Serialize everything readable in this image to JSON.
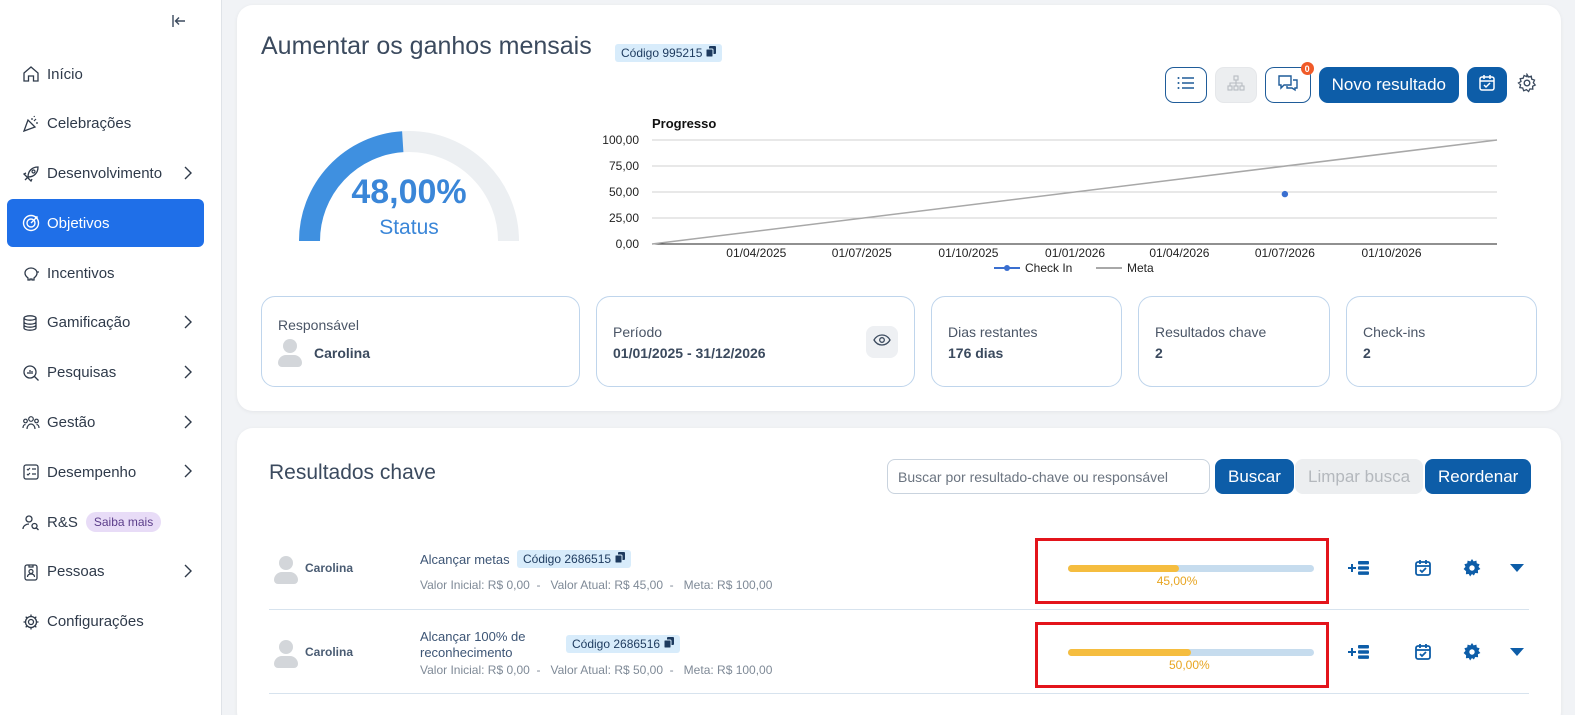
{
  "sidebar": {
    "items": [
      {
        "label": "Início"
      },
      {
        "label": "Celebrações"
      },
      {
        "label": "Desenvolvimento"
      },
      {
        "label": "Objetivos"
      },
      {
        "label": "Incentivos"
      },
      {
        "label": "Gamificação"
      },
      {
        "label": "Pesquisas"
      },
      {
        "label": "Gestão"
      },
      {
        "label": "Desempenho"
      },
      {
        "label": "R&S",
        "badge": "Saiba mais"
      },
      {
        "label": "Pessoas"
      },
      {
        "label": "Configurações"
      }
    ],
    "active": "Objetivos"
  },
  "objective": {
    "title": "Aumentar os ganhos mensais",
    "code": "Código 995215",
    "notification_count": "0",
    "new_result_label": "Novo resultado",
    "status_value": "48,00%",
    "status_progress": 0.48,
    "status_label": "Status"
  },
  "chart_data": {
    "type": "line",
    "title": "Progresso",
    "y_ticks": [
      "100,00",
      "75,00",
      "50,00",
      "25,00",
      "0,00"
    ],
    "ylim": [
      0,
      100
    ],
    "x_ticks": [
      "01/04/2025",
      "01/07/2025",
      "01/10/2025",
      "01/01/2026",
      "01/04/2026",
      "01/07/2026",
      "01/10/2026"
    ],
    "xlim": [
      "01/01/2025",
      "31/12/2026"
    ],
    "series": [
      {
        "name": "Check In",
        "color": "#3a6fd0",
        "points": [
          {
            "x": "01/07/2026",
            "y": 48
          }
        ]
      },
      {
        "name": "Meta",
        "color": "#a8a8a8",
        "points": [
          {
            "x": "01/01/2025",
            "y": 0
          },
          {
            "x": "31/12/2026",
            "y": 100
          }
        ]
      }
    ],
    "grid": true,
    "legend": "bottom-center"
  },
  "info": {
    "responsavel_label": "Responsável",
    "responsavel_name": "Carolina",
    "periodo_label": "Período",
    "periodo_value": "01/01/2025 - 31/12/2026",
    "dias_label": "Dias restantes",
    "dias_value": "176 dias",
    "kr_label": "Resultados chave",
    "kr_value": "2",
    "checkins_label": "Check-ins",
    "checkins_value": "2"
  },
  "key_results": {
    "title": "Resultados chave",
    "search_placeholder": "Buscar por resultado-chave ou responsável",
    "search_button": "Buscar",
    "clear_button": "Limpar busca",
    "reorder_button": "Reordenar",
    "rows": [
      {
        "owner": "Carolina",
        "name_line1": "Alcançar metas",
        "name_line2": "",
        "code": "Código 2686515",
        "values": "Valor Inicial: R$ 0,00  -   Valor Atual: R$ 45,00  -   Meta: R$ 100,00",
        "progress": 0.45,
        "progress_label": "45,00%"
      },
      {
        "owner": "Carolina",
        "name_line1": "Alcançar 100% de",
        "name_line2": "reconhecimento",
        "code": "Código 2686516",
        "values": "Valor Inicial: R$ 0,00  -   Valor Atual: R$ 50,00  -   Meta: R$ 100,00",
        "progress": 0.5,
        "progress_label": "50,00%"
      }
    ]
  }
}
